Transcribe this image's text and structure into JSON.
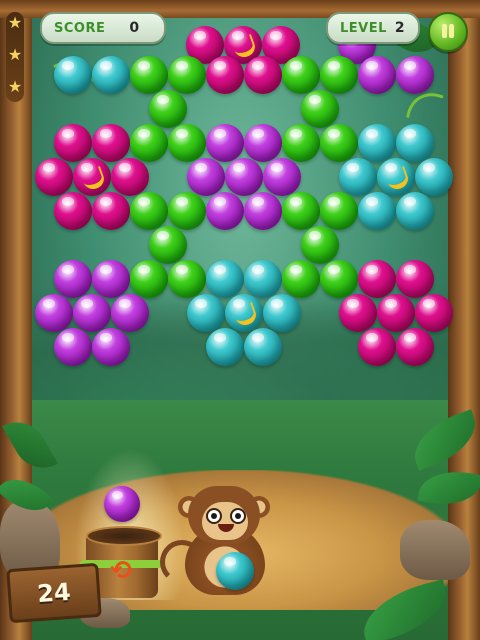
{
  "hud": {
    "score_label": "SCORE",
    "score_value": "0",
    "level_label": "LEVEL",
    "level_value": "2"
  },
  "shots_remaining": "24",
  "colors": {
    "magenta": "#e0108f",
    "green": "#3fd11a",
    "cyan": "#3fc9cf",
    "purple": "#c23fe0"
  },
  "icons": [
    "star-icon",
    "pause-icon",
    "swap-icon",
    "banana-icon"
  ],
  "next_bubble_color": "purple",
  "loaded_bubble_color": "cyan",
  "stars_earned_of": 3
}
